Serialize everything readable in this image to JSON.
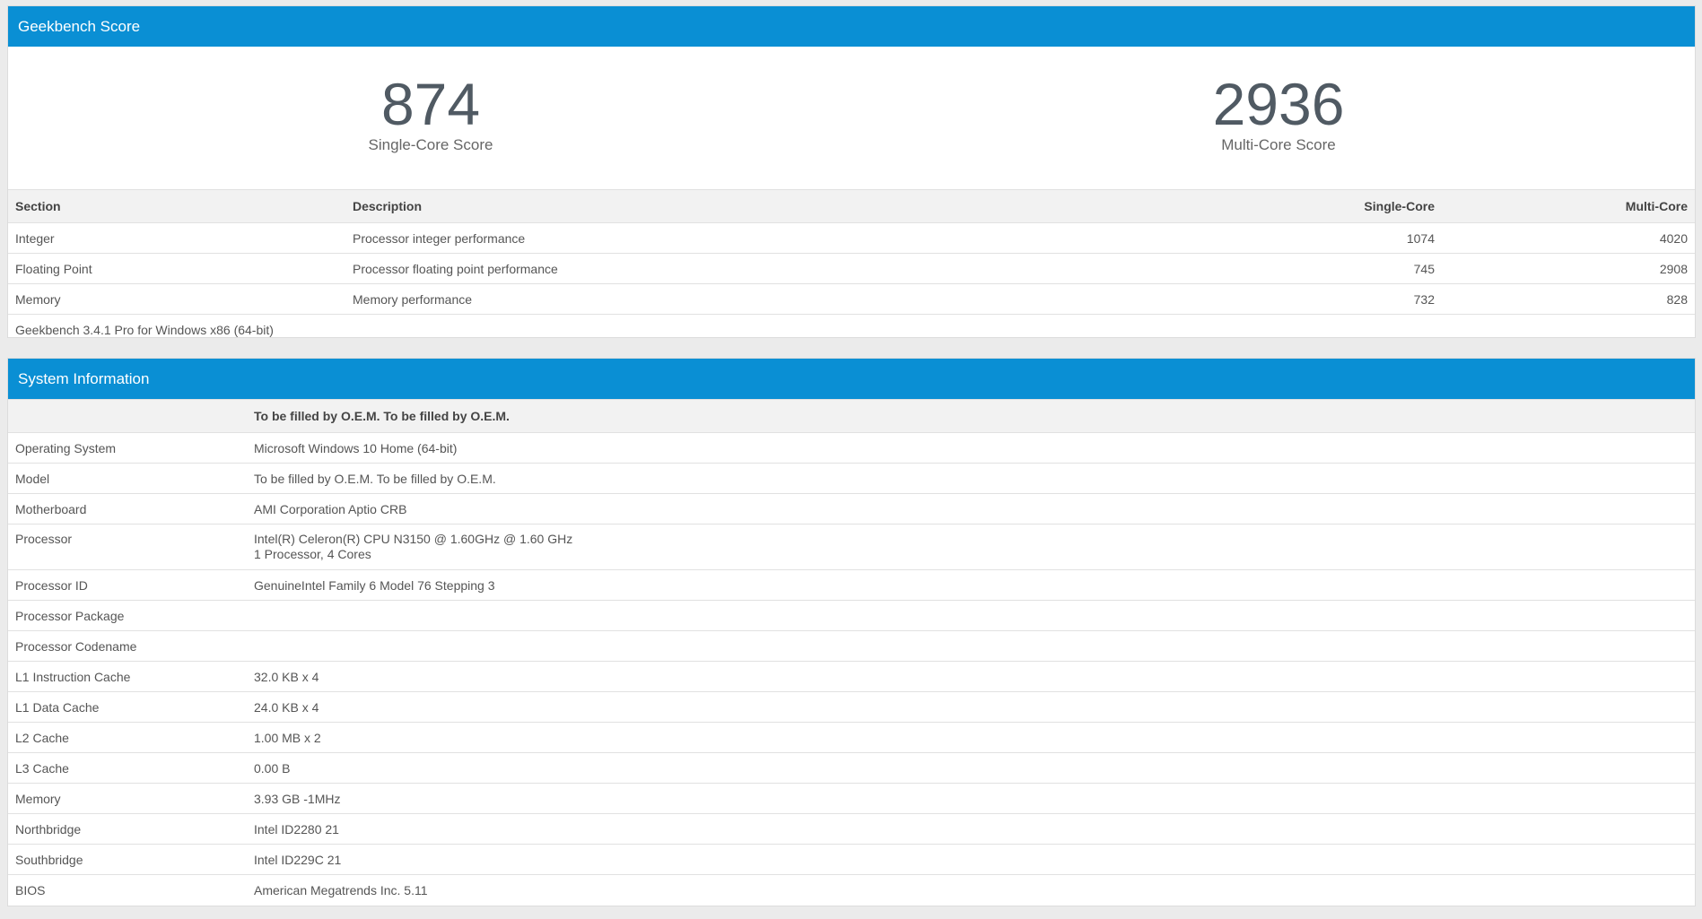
{
  "score_panel": {
    "title": "Geekbench Score",
    "single_core_score": "874",
    "single_core_label": "Single-Core Score",
    "multi_core_score": "2936",
    "multi_core_label": "Multi-Core Score",
    "headers": {
      "section": "Section",
      "description": "Description",
      "single_core": "Single-Core",
      "multi_core": "Multi-Core"
    },
    "rows": [
      {
        "section": "Integer",
        "description": "Processor integer performance",
        "single": "1074",
        "multi": "4020"
      },
      {
        "section": "Floating Point",
        "description": "Processor floating point performance",
        "single": "745",
        "multi": "2908"
      },
      {
        "section": "Memory",
        "description": "Memory performance",
        "single": "732",
        "multi": "828"
      }
    ],
    "footer": "Geekbench 3.4.1 Pro for Windows x86 (64-bit)"
  },
  "system_panel": {
    "title": "System Information",
    "header_value": "To be filled by O.E.M. To be filled by O.E.M.",
    "rows": [
      {
        "label": "Operating System",
        "value": "Microsoft Windows 10 Home (64-bit)"
      },
      {
        "label": "Model",
        "value": "To be filled by O.E.M. To be filled by O.E.M."
      },
      {
        "label": "Motherboard",
        "value": "AMI Corporation Aptio CRB"
      },
      {
        "label": "Processor",
        "value": "Intel(R) Celeron(R) CPU N3150 @ 1.60GHz @ 1.60 GHz",
        "value2": "1 Processor, 4 Cores"
      },
      {
        "label": "Processor ID",
        "value": "GenuineIntel Family 6 Model 76 Stepping 3"
      },
      {
        "label": "Processor Package",
        "value": ""
      },
      {
        "label": "Processor Codename",
        "value": ""
      },
      {
        "label": "L1 Instruction Cache",
        "value": "32.0 KB x 4"
      },
      {
        "label": "L1 Data Cache",
        "value": "24.0 KB x 4"
      },
      {
        "label": "L2 Cache",
        "value": "1.00 MB x 2"
      },
      {
        "label": "L3 Cache",
        "value": "0.00 B"
      },
      {
        "label": "Memory",
        "value": "3.93 GB -1MHz"
      },
      {
        "label": "Northbridge",
        "value": "Intel ID2280 21"
      },
      {
        "label": "Southbridge",
        "value": "Intel ID229C 21"
      },
      {
        "label": "BIOS",
        "value": "American Megatrends Inc. 5.11"
      }
    ]
  },
  "colors": {
    "header_blue": "#0a8fd4",
    "page_bg": "#ebebeb",
    "score_text": "#505a63"
  }
}
